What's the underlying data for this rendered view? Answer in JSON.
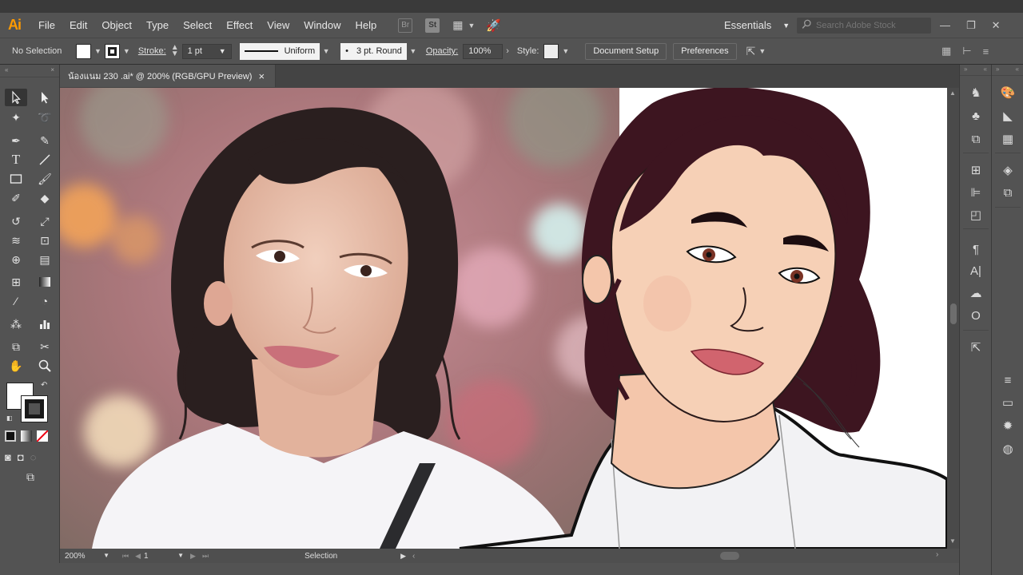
{
  "app": {
    "logo": "Ai",
    "menu": [
      "File",
      "Edit",
      "Object",
      "Type",
      "Select",
      "Effect",
      "View",
      "Window",
      "Help"
    ],
    "bridge_label": "Br",
    "stock_label": "St",
    "workspace": "Essentials",
    "search_placeholder": "Search Adobe Stock"
  },
  "control_bar": {
    "selection_state": "No Selection",
    "stroke_label": "Stroke:",
    "stroke_weight": "1 pt",
    "profile_label": "Uniform",
    "brush_label": "3 pt. Round",
    "opacity_label": "Opacity:",
    "opacity_value": "100%",
    "style_label": "Style:",
    "document_setup_label": "Document Setup",
    "preferences_label": "Preferences"
  },
  "document": {
    "tab_title": "น้องแนม 230 .ai* @ 200% (RGB/GPU Preview)",
    "close_glyph": "×"
  },
  "status_bar": {
    "zoom": "200%",
    "artboard": "1",
    "current_tool": "Selection"
  },
  "colors": {
    "ui_bg": "#535353",
    "accent_logo": "#ff9a00",
    "skin_vector": "#f6d0b6",
    "hair_vector": "#3d1520",
    "lips": "#d1646e"
  }
}
